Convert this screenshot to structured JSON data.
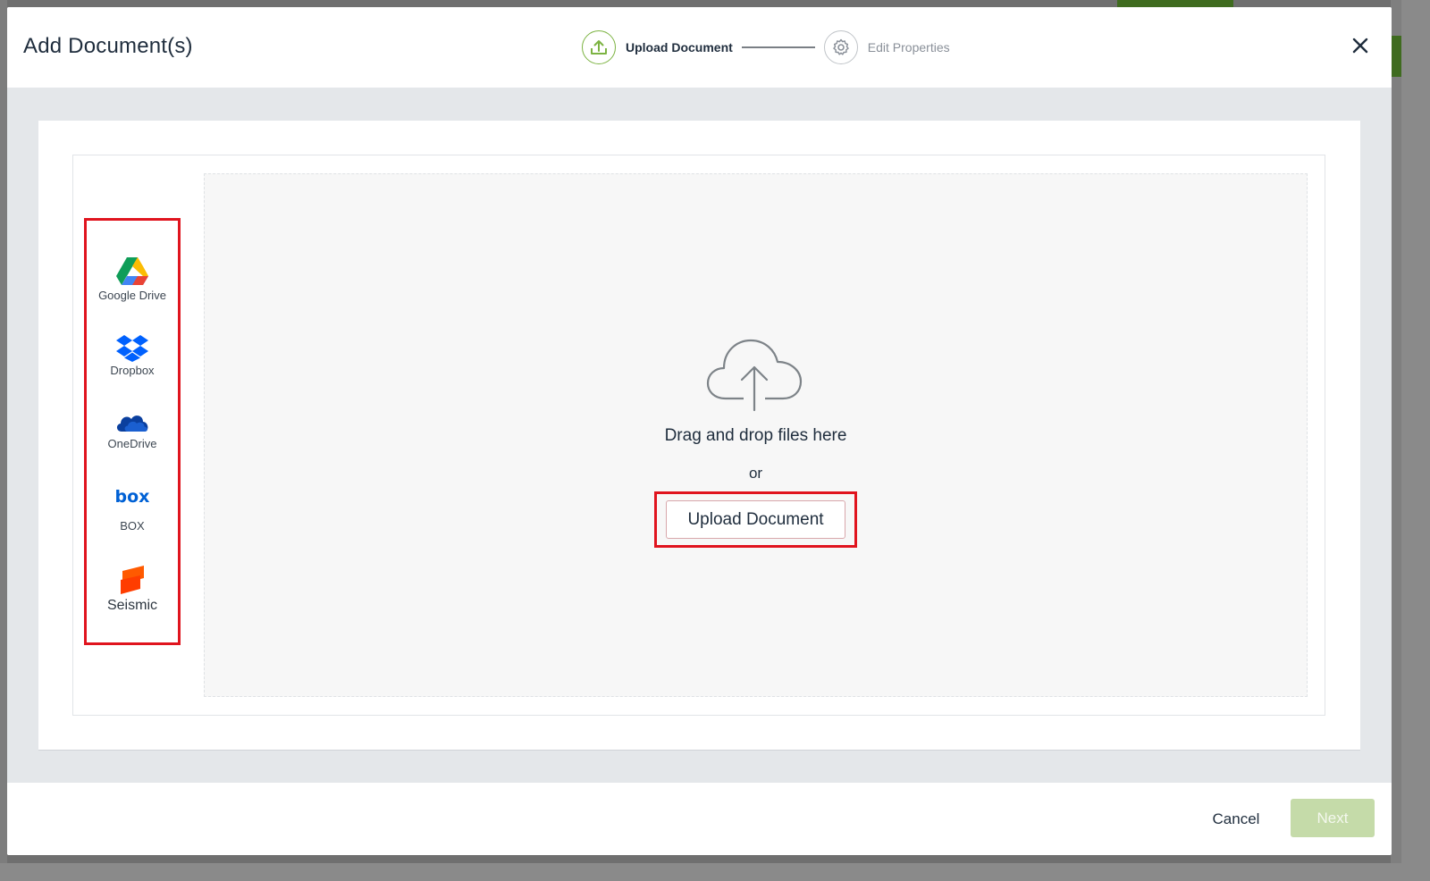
{
  "modal": {
    "title": "Add Document(s)"
  },
  "stepper": {
    "steps": [
      {
        "label": "Upload Document",
        "icon": "upload-icon",
        "active": true
      },
      {
        "label": "Edit Properties",
        "icon": "gear-icon",
        "active": false
      }
    ]
  },
  "sources": [
    {
      "label": "Google Drive",
      "icon": "google-drive-icon"
    },
    {
      "label": "Dropbox",
      "icon": "dropbox-icon"
    },
    {
      "label": "OneDrive",
      "icon": "onedrive-icon"
    },
    {
      "label": "BOX",
      "icon": "box-icon"
    },
    {
      "label": "Seismic",
      "icon": "seismic-icon"
    }
  ],
  "dropzone": {
    "drag_text": "Drag and drop files here",
    "or_text": "or",
    "upload_label": "Upload Document"
  },
  "footer": {
    "cancel_label": "Cancel",
    "next_label": "Next"
  },
  "colors": {
    "accent_green": "#7cb342",
    "next_disabled": "#c5dba9",
    "highlight_red": "#e0141e",
    "text_dark": "#1f2d3d"
  }
}
